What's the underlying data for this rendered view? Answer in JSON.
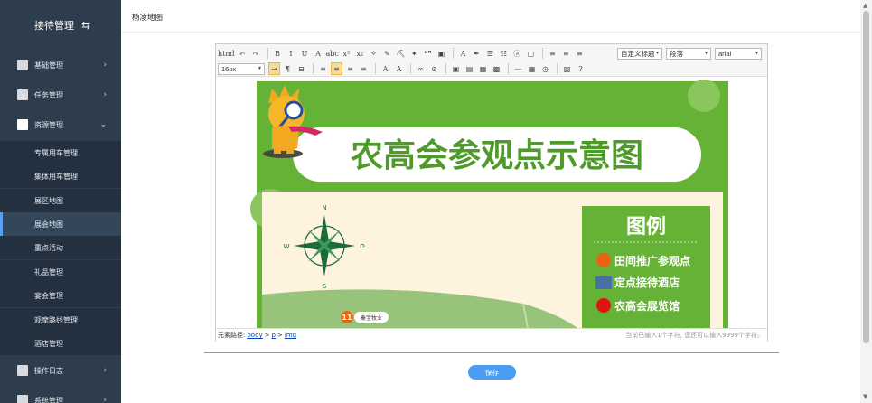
{
  "sidebar": {
    "title": "接待管理",
    "switch_icon": "⇆",
    "menus": [
      {
        "label": "基础管理",
        "chev": "›"
      },
      {
        "label": "任务管理",
        "chev": "›"
      },
      {
        "label": "资源管理",
        "chev": "⌄"
      }
    ],
    "subitems": [
      "专属用车管理",
      "集体用车管理",
      "展区地图",
      "展会地图",
      "重点活动",
      "礼品管理",
      "宴会管理",
      "观摩路线管理",
      "酒店管理"
    ],
    "bottom_menus": [
      {
        "label": "操作日志",
        "chev": "›"
      },
      {
        "label": "系统管理",
        "chev": "›"
      }
    ]
  },
  "header": {
    "title": "杨凌地图"
  },
  "toolbar": {
    "font_size": "16px",
    "custom_title": "自定义标题",
    "paragraph": "段落",
    "font_family": "arial",
    "row1": [
      "html",
      "↶",
      "↷",
      "B",
      "I",
      "U",
      "A",
      "abc",
      "x²",
      "x₂",
      "⟡",
      "✎",
      "⛏",
      "✦",
      "❝❞",
      "▣",
      "A",
      "✒",
      "☰",
      "☷",
      "ⓐ",
      "▢",
      "≡",
      "≡",
      "≡"
    ],
    "row2": [
      "⇥",
      "¶",
      "⊟",
      "≡",
      "≡",
      "≡",
      "≡",
      "A",
      "A",
      "∞",
      "⊘",
      "▣",
      "▤",
      "▦",
      "▩",
      "—",
      "▦",
      "◷",
      "▧",
      "?"
    ]
  },
  "image": {
    "banner_title": "农高会参观点示意图",
    "legend_title": "图例",
    "legend_items": [
      {
        "label": "田间推广参观点",
        "color": "#e8640f"
      },
      {
        "label": "定点接待酒店",
        "color": "#4a6fa5"
      },
      {
        "label": "农高会展览馆",
        "color": "#e31212"
      }
    ],
    "compass": {
      "n": "N",
      "s": "S",
      "w": "W",
      "e": "O"
    },
    "map_marker": {
      "number": "11",
      "label": "秦宝牧业"
    },
    "colors": {
      "green": "#66b237",
      "cream": "#fdf3df",
      "title_green": "#4e9a2a"
    }
  },
  "status": {
    "path_label": "元素路径:",
    "path": [
      "body",
      "p",
      "img"
    ],
    "separator": ">",
    "count": "当前已输入1个字符, 您还可以输入9999个字符。"
  },
  "save_label": "保存",
  "scroll": {
    "up": "▲",
    "down": "▼"
  }
}
